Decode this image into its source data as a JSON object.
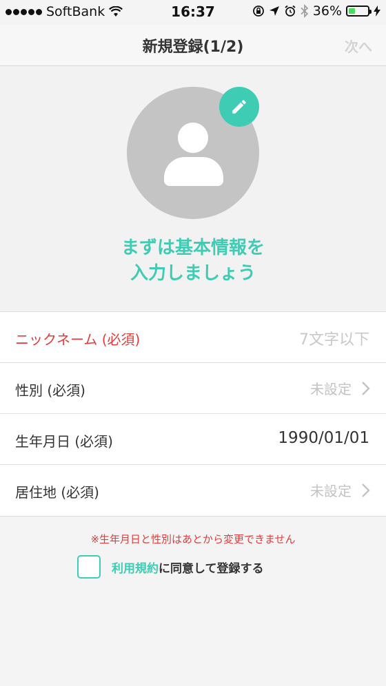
{
  "status_bar": {
    "carrier": "SoftBank",
    "time": "16:37",
    "battery_percent": "36%",
    "battery_level": 0.36,
    "icons": [
      "signal-dots",
      "wifi-icon",
      "rotation-lock-icon",
      "location-arrow-icon",
      "alarm-icon",
      "bluetooth-icon",
      "battery-icon",
      "charging-bolt-icon"
    ]
  },
  "nav": {
    "title": "新規登録(1/2)",
    "next_label": "次へ"
  },
  "profile": {
    "avatar_icon": "person-icon",
    "edit_icon": "pencil-icon",
    "intro_line1": "まずは基本情報を",
    "intro_line2": "入力しましょう"
  },
  "form": {
    "nickname": {
      "label": "ニックネーム (必須)",
      "placeholder": "7文字以下"
    },
    "gender": {
      "label": "性別 (必須)",
      "value": "未設定"
    },
    "birthday": {
      "label": "生年月日 (必須)",
      "value": "1990/01/01"
    },
    "residence": {
      "label": "居住地 (必須)",
      "value": "未設定"
    }
  },
  "note": "※生年月日と性別はあとから変更できません",
  "agreement": {
    "terms_link": "利用規約",
    "suffix": "に同意して登録する",
    "checked": false
  },
  "colors": {
    "accent": "#3ecdb4",
    "required": "#e23b3b",
    "avatar_bg": "#c4c4c4"
  }
}
